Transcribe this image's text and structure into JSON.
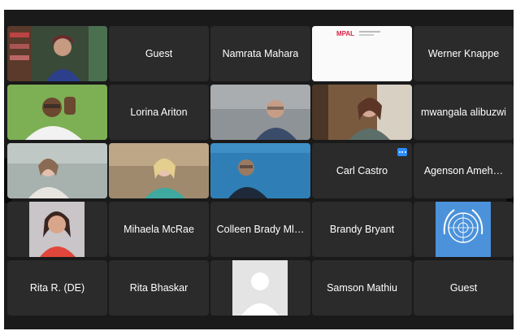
{
  "meeting": {
    "participants": [
      {
        "id": "p1",
        "name": "",
        "type": "video",
        "speaker": true
      },
      {
        "id": "p2",
        "name": "Guest",
        "type": "name"
      },
      {
        "id": "p3",
        "name": "Namrata Mahara",
        "type": "name"
      },
      {
        "id": "p4",
        "name": "",
        "type": "screen"
      },
      {
        "id": "p5",
        "name": "Werner Knappe",
        "type": "name"
      },
      {
        "id": "p6",
        "name": "",
        "type": "video"
      },
      {
        "id": "p7",
        "name": "Lorina Ariton",
        "type": "name"
      },
      {
        "id": "p8",
        "name": "",
        "type": "video"
      },
      {
        "id": "p9",
        "name": "",
        "type": "video"
      },
      {
        "id": "p10",
        "name": "mwangala alibuzwi",
        "type": "name"
      },
      {
        "id": "p11",
        "name": "",
        "type": "video"
      },
      {
        "id": "p12",
        "name": "",
        "type": "video"
      },
      {
        "id": "p13",
        "name": "",
        "type": "video"
      },
      {
        "id": "p14",
        "name": "Carl Castro",
        "type": "name",
        "menu": true
      },
      {
        "id": "p15",
        "name": "Agenson Ameh…",
        "type": "name"
      },
      {
        "id": "p16",
        "name": "",
        "type": "video"
      },
      {
        "id": "p17",
        "name": "Mihaela McRae",
        "type": "name"
      },
      {
        "id": "p18",
        "name": "Colleen Brady Ml…",
        "type": "name"
      },
      {
        "id": "p19",
        "name": "Brandy Bryant",
        "type": "name"
      },
      {
        "id": "p20",
        "name": "",
        "type": "logo"
      },
      {
        "id": "p21",
        "name": "Rita R. (DE)",
        "type": "name"
      },
      {
        "id": "p22",
        "name": "Rita Bhaskar",
        "type": "name"
      },
      {
        "id": "p23",
        "name": "",
        "type": "avatar"
      },
      {
        "id": "p24",
        "name": "Samson Mathiu",
        "type": "name"
      },
      {
        "id": "p25",
        "name": "Guest",
        "type": "name"
      }
    ],
    "screen_share_logo": "MPAL",
    "colors": {
      "speaker": "#2bd15a",
      "accent": "#2d8cff",
      "un_blue": "#4b92db"
    }
  }
}
